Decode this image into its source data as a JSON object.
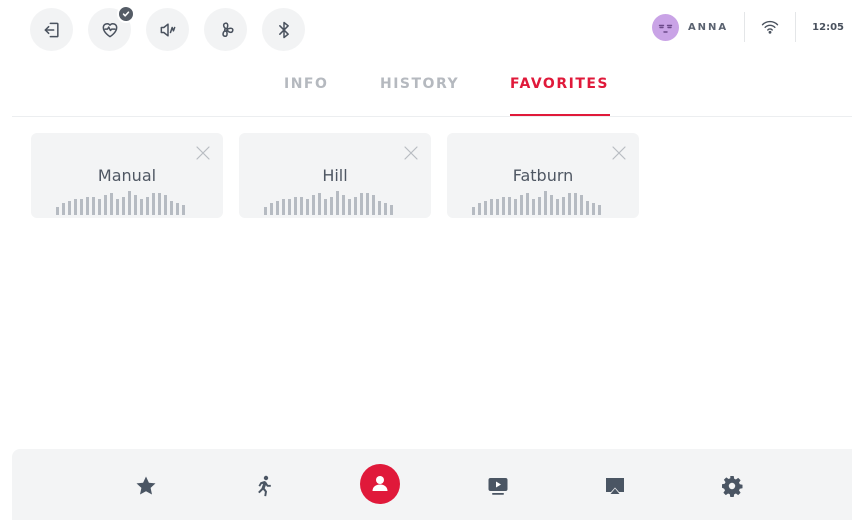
{
  "topbar": {
    "icons": [
      "exit-icon",
      "heart-rate-icon",
      "volume-muted-icon",
      "fan-icon",
      "bluetooth-icon"
    ],
    "heart_rate_badge": "check-icon",
    "user_name": "ANNA",
    "time": "12:05"
  },
  "tabs": [
    {
      "label": "INFO",
      "active": false
    },
    {
      "label": "HISTORY",
      "active": false
    },
    {
      "label": "FAVORITES",
      "active": true
    }
  ],
  "favorites": [
    {
      "name": "Manual",
      "profile": [
        8,
        12,
        14,
        16,
        16,
        18,
        18,
        16,
        20,
        22,
        16,
        18,
        24,
        20,
        16,
        18,
        22,
        22,
        20,
        14,
        12,
        10
      ]
    },
    {
      "name": "Hill",
      "profile": [
        8,
        12,
        14,
        16,
        16,
        18,
        18,
        16,
        20,
        22,
        16,
        18,
        24,
        20,
        16,
        18,
        22,
        22,
        20,
        14,
        12,
        10
      ]
    },
    {
      "name": "Fatburn",
      "profile": [
        8,
        12,
        14,
        16,
        16,
        18,
        18,
        16,
        20,
        22,
        16,
        18,
        24,
        20,
        16,
        18,
        22,
        22,
        20,
        14,
        12,
        10
      ]
    }
  ],
  "bottom_nav": {
    "items": [
      "star-icon",
      "runner-icon",
      "profile-icon",
      "video-icon",
      "cast-icon",
      "settings-icon"
    ],
    "active": "profile-icon"
  },
  "colors": {
    "accent": "#e0193a",
    "icon": "#5a6270",
    "card_bg": "#f3f4f5",
    "bar": "#b6bbc2",
    "avatar": "#c9a3e6"
  }
}
